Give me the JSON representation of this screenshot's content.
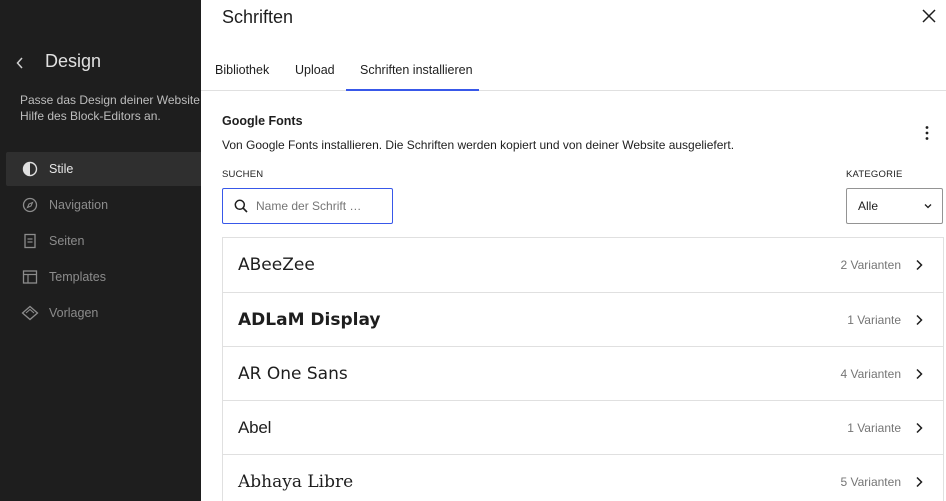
{
  "sidebar": {
    "title": "Design",
    "description": "Passe das Design deiner Website m\nHilfe des Block-Editors an.",
    "items": [
      {
        "label": "Stile",
        "icon": "half-circle-icon",
        "active": true
      },
      {
        "label": "Navigation",
        "icon": "compass-icon",
        "active": false
      },
      {
        "label": "Seiten",
        "icon": "page-icon",
        "active": false
      },
      {
        "label": "Templates",
        "icon": "layout-icon",
        "active": false
      },
      {
        "label": "Vorlagen",
        "icon": "diamond-icon",
        "active": false
      }
    ]
  },
  "modal": {
    "title": "Schriften",
    "tabs": [
      {
        "label": "Bibliothek",
        "active": false
      },
      {
        "label": "Upload",
        "active": false
      },
      {
        "label": "Schriften installieren",
        "active": true
      }
    ],
    "section_title": "Google Fonts",
    "section_description": "Von Google Fonts installieren. Die Schriften werden kopiert und von deiner Website ausgeliefert.",
    "search": {
      "label": "SUCHEN",
      "placeholder": "Name der Schrift …",
      "value": ""
    },
    "category": {
      "label": "KATEGORIE",
      "selected": "Alle"
    },
    "fonts": [
      {
        "name": "ABeeZee",
        "variants": "2 Varianten"
      },
      {
        "name": "ADLaM Display",
        "variants": "1 Variante"
      },
      {
        "name": "AR One Sans",
        "variants": "4 Varianten"
      },
      {
        "name": "Abel",
        "variants": "1 Variante"
      },
      {
        "name": "Abhaya Libre",
        "variants": "5 Varianten"
      }
    ]
  }
}
